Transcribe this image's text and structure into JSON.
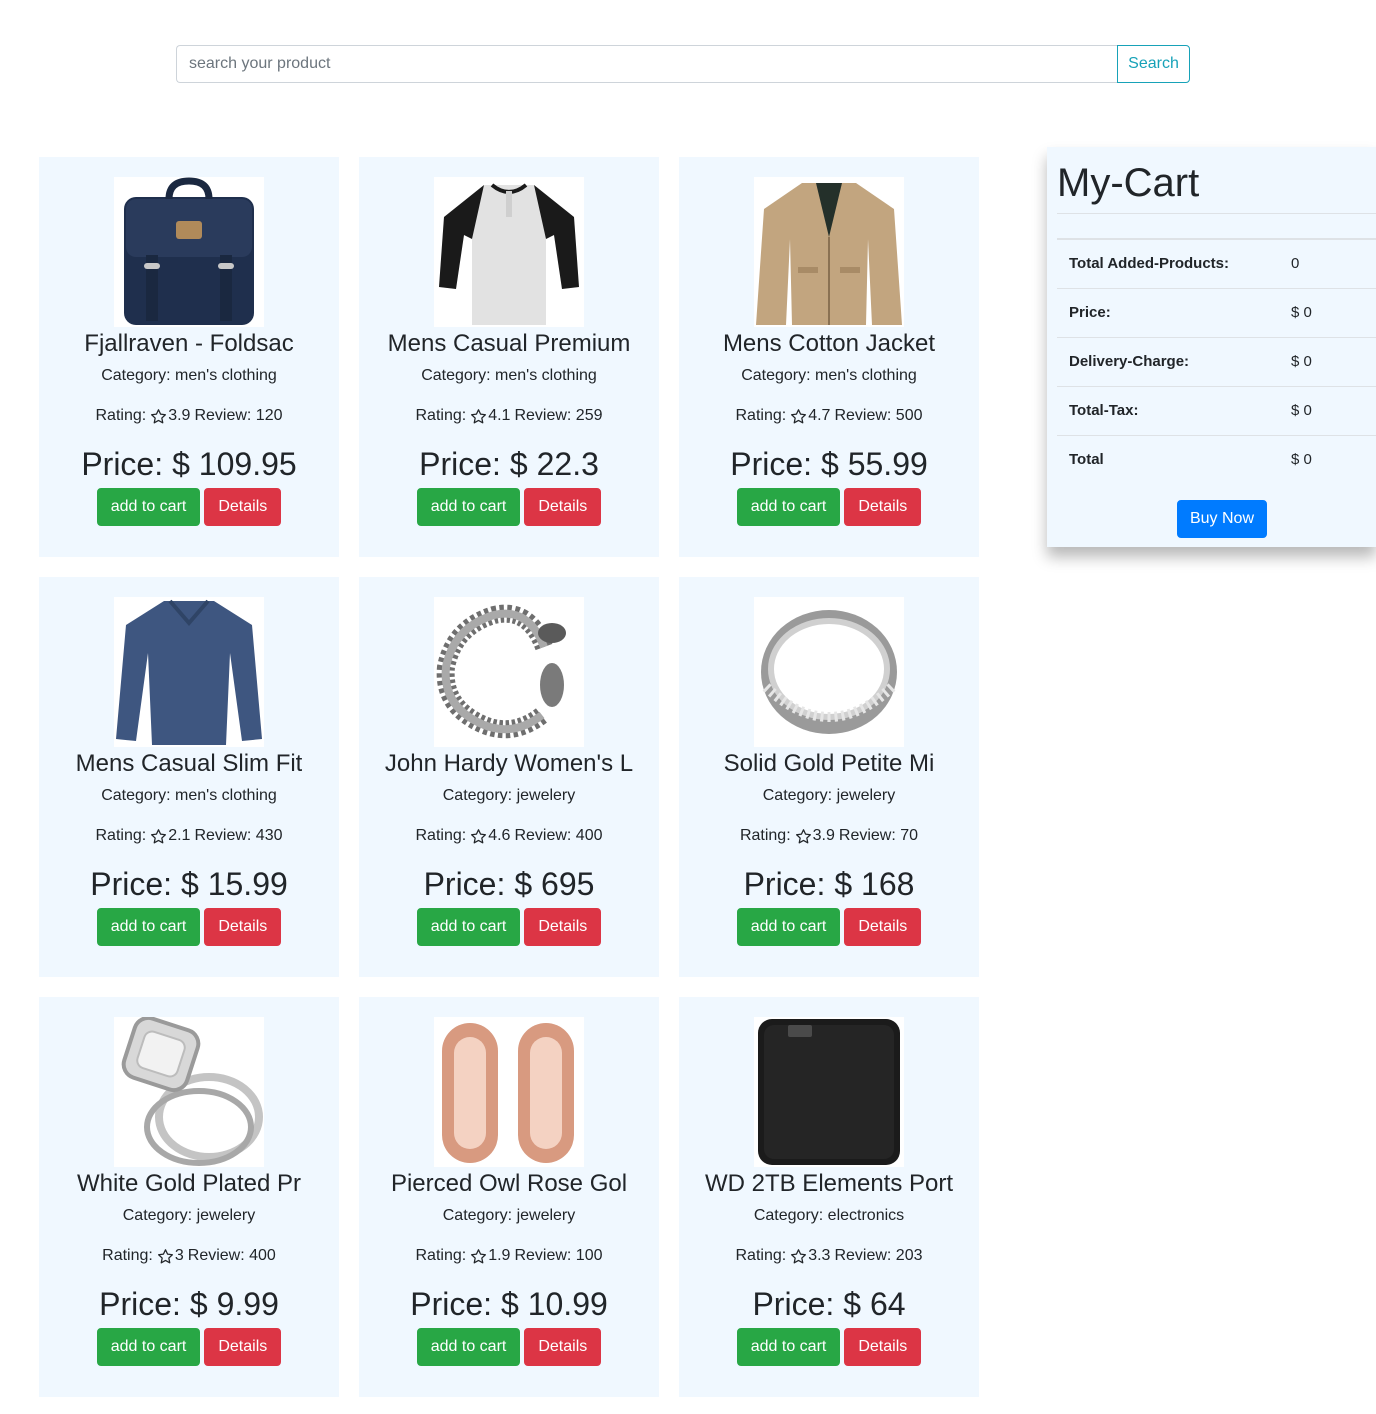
{
  "search": {
    "placeholder": "search your product",
    "button_label": "Search"
  },
  "labels": {
    "category": "Category:",
    "rating": "Rating:",
    "review": "Review:",
    "price": "Price:",
    "add_to_cart": "add to cart",
    "details": "Details"
  },
  "products": [
    {
      "title": "Fjallraven - Foldsac",
      "category": "men's clothing",
      "rating": "3.9",
      "review": "120",
      "price": "$ 109.95",
      "image": "backpack-image"
    },
    {
      "title": "Mens Casual Premium",
      "category": "men's clothing",
      "rating": "4.1",
      "review": "259",
      "price": "$ 22.3",
      "image": "raglan-shirt-image"
    },
    {
      "title": "Mens Cotton Jacket",
      "category": "men's clothing",
      "rating": "4.7",
      "review": "500",
      "price": "$ 55.99",
      "image": "jacket-image"
    },
    {
      "title": "Mens Casual Slim Fit",
      "category": "men's clothing",
      "rating": "2.1",
      "review": "430",
      "price": "$ 15.99",
      "image": "long-sleeve-tee-image"
    },
    {
      "title": "John Hardy Women's L",
      "category": "jewelery",
      "rating": "4.6",
      "review": "400",
      "price": "$ 695",
      "image": "dragon-bracelet-image"
    },
    {
      "title": "Solid Gold Petite Mi",
      "category": "jewelery",
      "rating": "3.9",
      "review": "70",
      "price": "$ 168",
      "image": "silver-ring-image"
    },
    {
      "title": "White Gold Plated Pr",
      "category": "jewelery",
      "rating": "3",
      "review": "400",
      "price": "$ 9.99",
      "image": "diamond-ring-image"
    },
    {
      "title": "Pierced Owl Rose Gol",
      "category": "jewelery",
      "rating": "1.9",
      "review": "100",
      "price": "$ 10.99",
      "image": "rose-gold-tunnels-image"
    },
    {
      "title": "WD 2TB Elements Port",
      "category": "electronics",
      "rating": "3.3",
      "review": "203",
      "price": "$ 64",
      "image": "hard-drive-image"
    }
  ],
  "cart": {
    "title": "My-Cart",
    "rows": [
      {
        "label": "Total Added-Products:",
        "value": "0"
      },
      {
        "label": "Price:",
        "value": "$ 0"
      },
      {
        "label": "Delivery-Charge:",
        "value": "$ 0"
      },
      {
        "label": "Total-Tax:",
        "value": "$ 0"
      },
      {
        "label": "Total",
        "value": "$ 0"
      }
    ],
    "buy_label": "Buy Now"
  },
  "colors": {
    "card_bg": "#f0f8ff",
    "add_to_cart": "#28a745",
    "details": "#dc3545",
    "buy_now": "#007bff",
    "search_outline": "#17a2b8"
  }
}
